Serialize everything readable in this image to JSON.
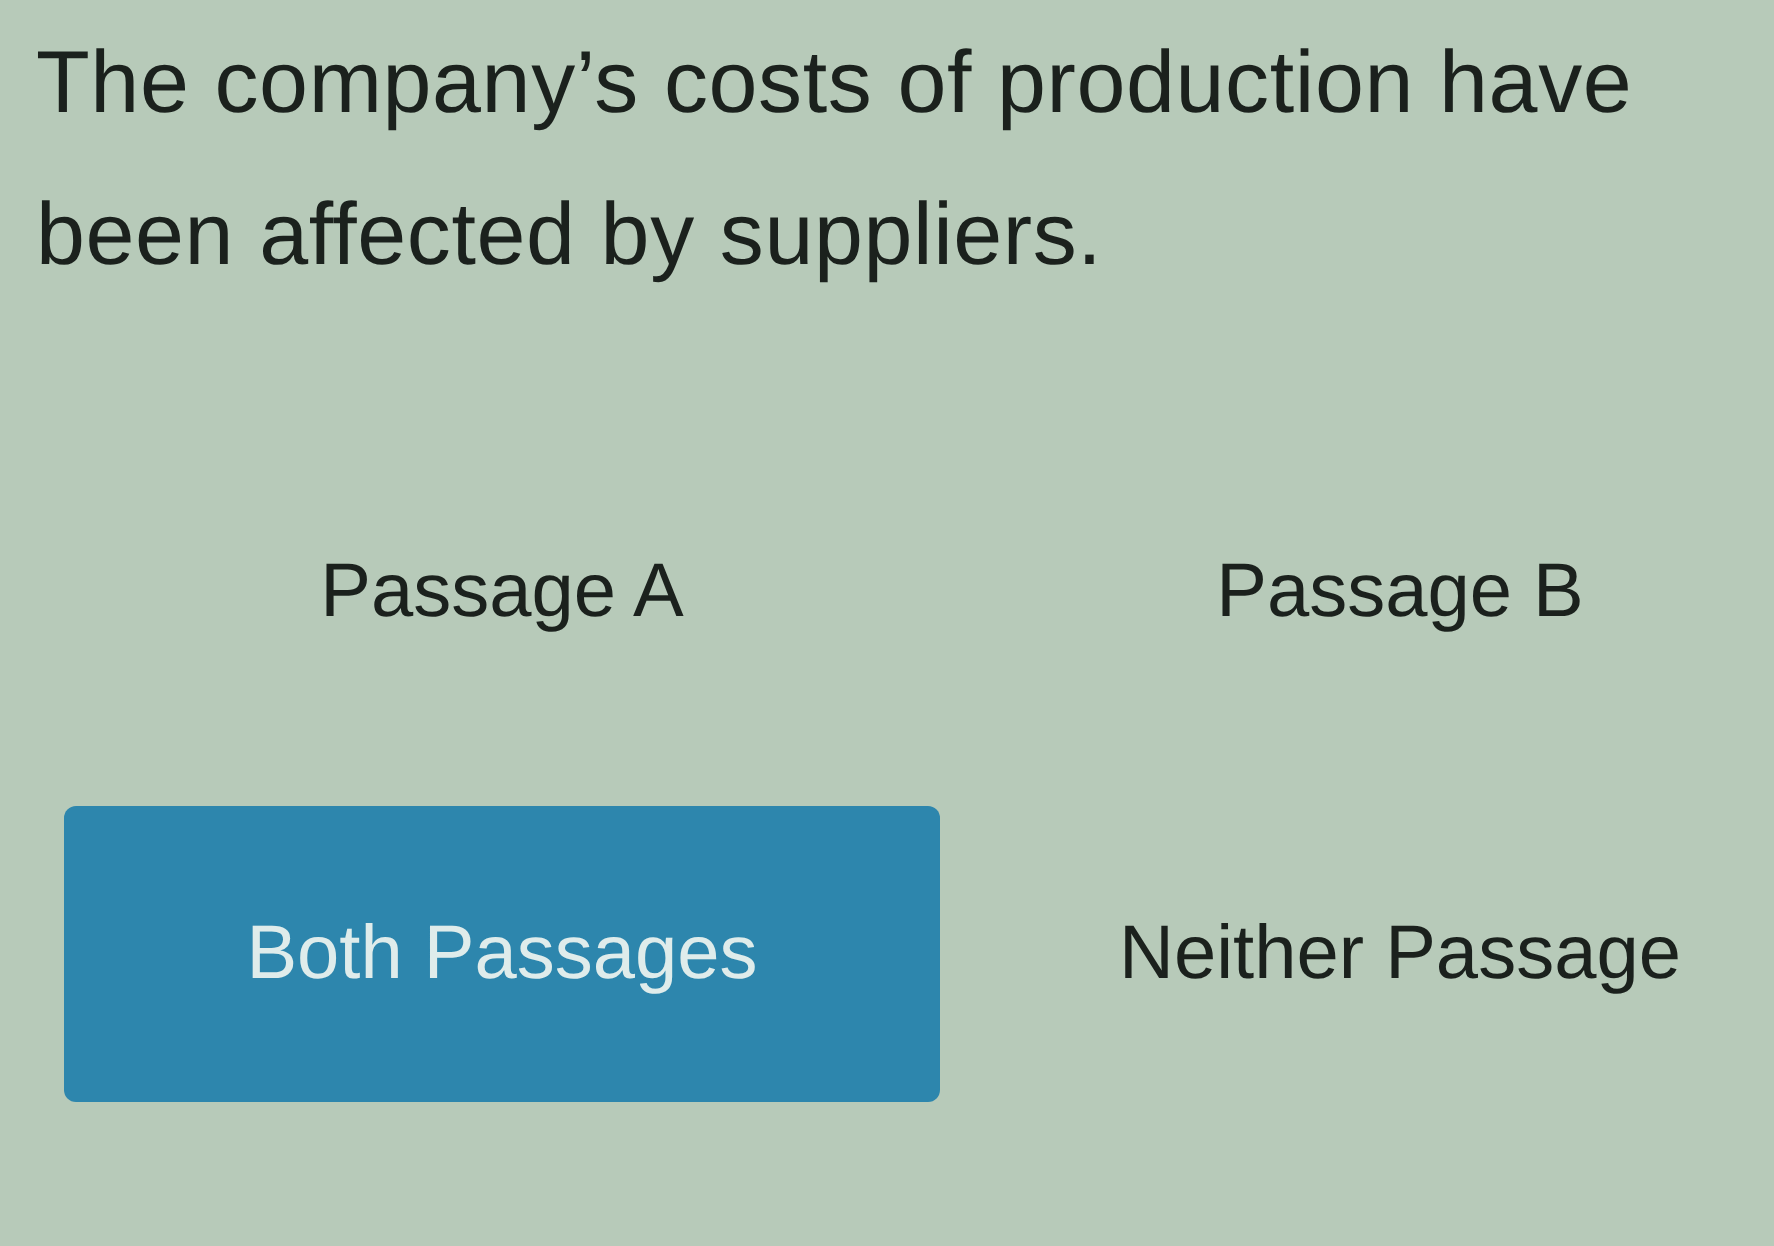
{
  "prompt": "The company’s costs of production have been affected by suppliers.",
  "options": [
    {
      "label": "Passage A",
      "selected": false
    },
    {
      "label": "Passage B",
      "selected": false
    },
    {
      "label": "Both Passages",
      "selected": true
    },
    {
      "label": "Neither Passage",
      "selected": false
    }
  ]
}
